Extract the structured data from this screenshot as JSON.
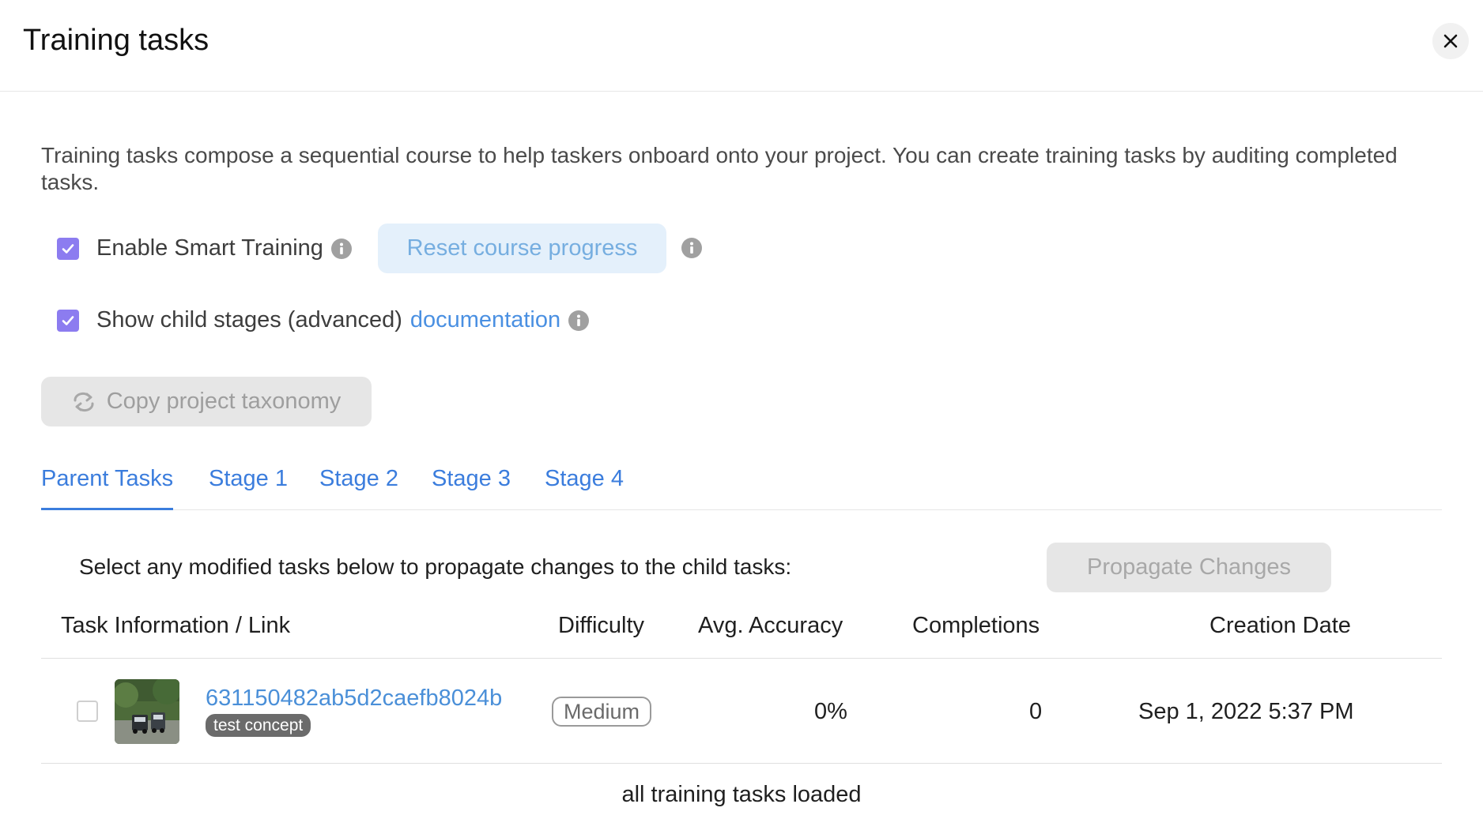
{
  "header": {
    "title": "Training tasks"
  },
  "description": "Training tasks compose a sequential course to help taskers onboard onto your project. You can create training tasks by auditing completed tasks.",
  "options": {
    "smart_training_label": "Enable Smart Training",
    "smart_training_checked": true,
    "reset_label": "Reset course progress",
    "child_stages_label": "Show child stages (advanced)",
    "child_stages_checked": true,
    "documentation_link": "documentation"
  },
  "copy_button": {
    "label": "Copy project taxonomy"
  },
  "tabs": [
    {
      "label": "Parent Tasks",
      "active": true
    },
    {
      "label": "Stage 1"
    },
    {
      "label": "Stage 2"
    },
    {
      "label": "Stage 3"
    },
    {
      "label": "Stage 4"
    }
  ],
  "propagate": {
    "instruction": "Select any modified tasks below to propagate changes to the child tasks:",
    "button_label": "Propagate Changes"
  },
  "table": {
    "columns": [
      "Task Information / Link",
      "Difficulty",
      "Avg. Accuracy",
      "Completions",
      "Creation Date"
    ],
    "rows": [
      {
        "task_id": "631150482ab5d2caefb8024b",
        "tag": "test concept",
        "difficulty": "Medium",
        "accuracy": "0%",
        "completions": "0",
        "created": "Sep 1, 2022 5:37 PM",
        "selected": false
      }
    ]
  },
  "footer": {
    "status": "all training tasks loaded"
  },
  "colors": {
    "accent": "#3b7ddd",
    "checkbox": "#8c7cf0",
    "link": "#4a90e2"
  }
}
